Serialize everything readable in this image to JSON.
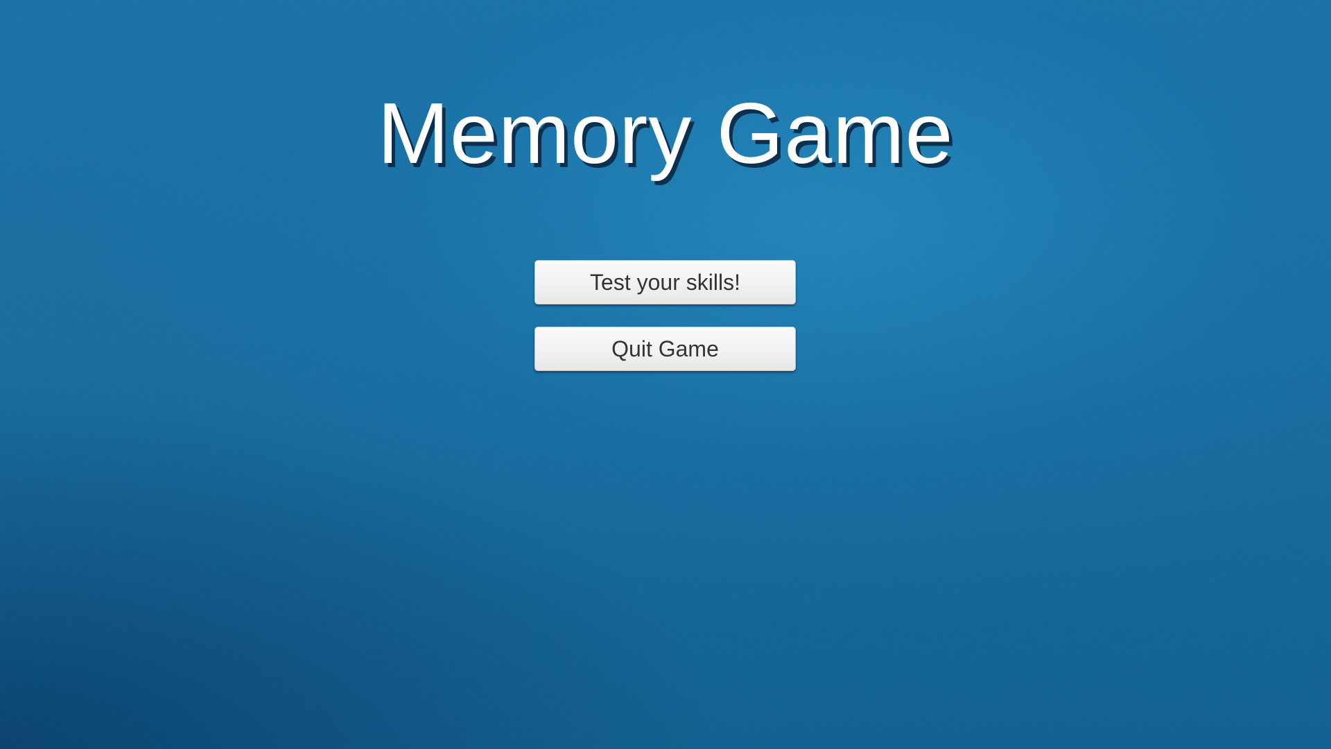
{
  "screen": "main-menu",
  "title": "Memory Game",
  "menu": {
    "buttons": [
      {
        "label": "Test your skills!"
      },
      {
        "label": "Quit Game"
      }
    ]
  },
  "colors": {
    "background": "#186597",
    "title_text": "#ffffff",
    "button_face": "#f2f2f2",
    "button_text": "#333333"
  }
}
